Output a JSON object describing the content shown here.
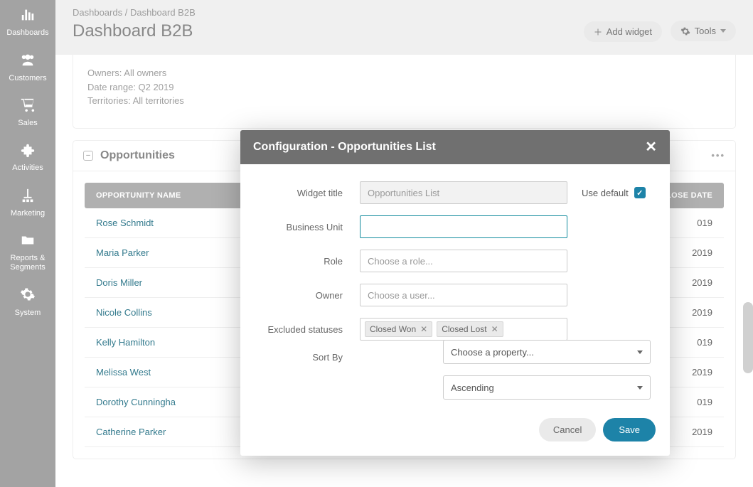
{
  "sidebar": {
    "items": [
      {
        "label": "Dashboards",
        "icon": "chart"
      },
      {
        "label": "Customers",
        "icon": "users"
      },
      {
        "label": "Sales",
        "icon": "cart"
      },
      {
        "label": "Activities",
        "icon": "puzzle"
      },
      {
        "label": "Marketing",
        "icon": "tree"
      },
      {
        "label": "Reports & Segments",
        "icon": "folder"
      },
      {
        "label": "System",
        "icon": "gear"
      }
    ]
  },
  "breadcrumb": {
    "parent": "Dashboards",
    "sep": " / ",
    "current": "Dashboard B2B"
  },
  "page_title": "Dashboard B2B",
  "toolbar": {
    "add": "Add widget",
    "tools": "Tools"
  },
  "filters": {
    "owners": "Owners: All owners",
    "dates": "Date range: Q2 2019",
    "terr": "Territories: All territories"
  },
  "widget": {
    "title": "Opportunities",
    "menu": "•••",
    "cols": {
      "name": "OPPORTUNITY NAME",
      "date": "D CLOSE DATE"
    }
  },
  "rows": [
    {
      "name": "Rose Schmidt",
      "date": "019"
    },
    {
      "name": "Maria Parker",
      "date": "2019"
    },
    {
      "name": "Doris Miller",
      "date": "2019"
    },
    {
      "name": "Nicole Collins",
      "date": "2019"
    },
    {
      "name": "Kelly Hamilton",
      "date": "019"
    },
    {
      "name": "Melissa West",
      "date": "2019"
    },
    {
      "name": "Dorothy Cunningha",
      "date": "019"
    },
    {
      "name": "Catherine Parker",
      "date": "2019"
    }
  ],
  "modal": {
    "title": "Configuration - Opportunities List",
    "labels": {
      "wt": "Widget title",
      "bu": "Business Unit",
      "role": "Role",
      "owner": "Owner",
      "excl": "Excluded statuses",
      "sort": "Sort By",
      "usedef": "Use default",
      "cancel": "Cancel",
      "save": "Save"
    },
    "placeholders": {
      "wt": "Opportunities List",
      "role": "Choose a role...",
      "owner": "Choose a user..."
    },
    "excluded": [
      "Closed Won",
      "Closed Lost"
    ],
    "sort_prop": "Choose a property...",
    "sort_dir": "Ascending"
  }
}
